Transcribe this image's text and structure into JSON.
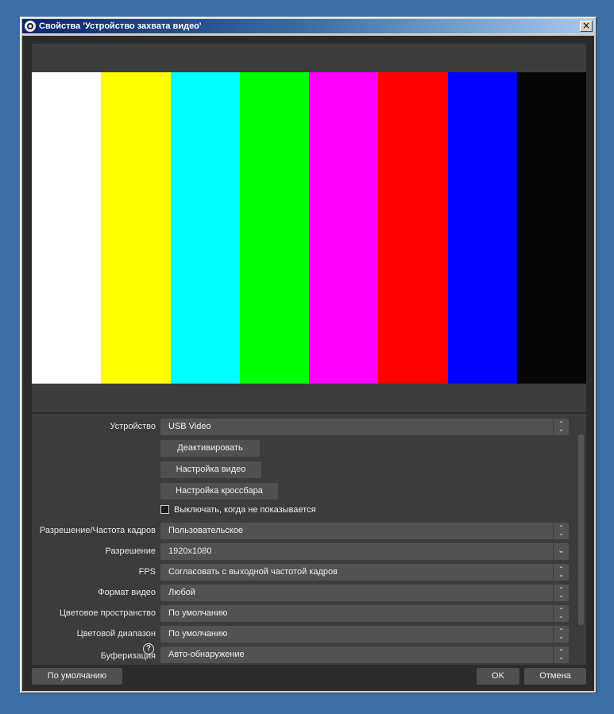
{
  "window": {
    "title": "Свойства 'Устройство захвата видео'",
    "close_glyph": "×"
  },
  "preview": {
    "color_bars": [
      "#ffffff",
      "#ffff00",
      "#00ffff",
      "#00ff00",
      "#ff00ff",
      "#ff0000",
      "#0000ff",
      "#050505"
    ]
  },
  "properties": {
    "device": {
      "label": "Устройство",
      "value": "USB Video"
    },
    "buttons": {
      "deactivate": "Деактивировать",
      "video_settings": "Настройка видео",
      "crossbar_settings": "Настройка кроссбара"
    },
    "deactivate_when_hidden": {
      "label": "Выключать, когда не показывается",
      "checked": false
    },
    "res_fps_type": {
      "label": "Разрешение/Частота кадров",
      "value": "Пользовательское"
    },
    "resolution": {
      "label": "Разрешение",
      "value": "1920x1080"
    },
    "fps": {
      "label": "FPS",
      "value": "Согласовать с выходной частотой кадров"
    },
    "video_format": {
      "label": "Формат видео",
      "value": "Любой"
    },
    "color_space": {
      "label": "Цветовое пространство",
      "value": "По умолчанию"
    },
    "color_range": {
      "label": "Цветовой диапазон",
      "value": "По умолчанию"
    },
    "buffering": {
      "label": "Буферизация",
      "value": "Авто-обнаружение",
      "help_glyph": "?"
    }
  },
  "footer": {
    "defaults": "По умолчанию",
    "ok": "OK",
    "cancel": "Отмена"
  },
  "icons": {
    "updown": "⌃⌄",
    "dropdown": "⌄"
  }
}
